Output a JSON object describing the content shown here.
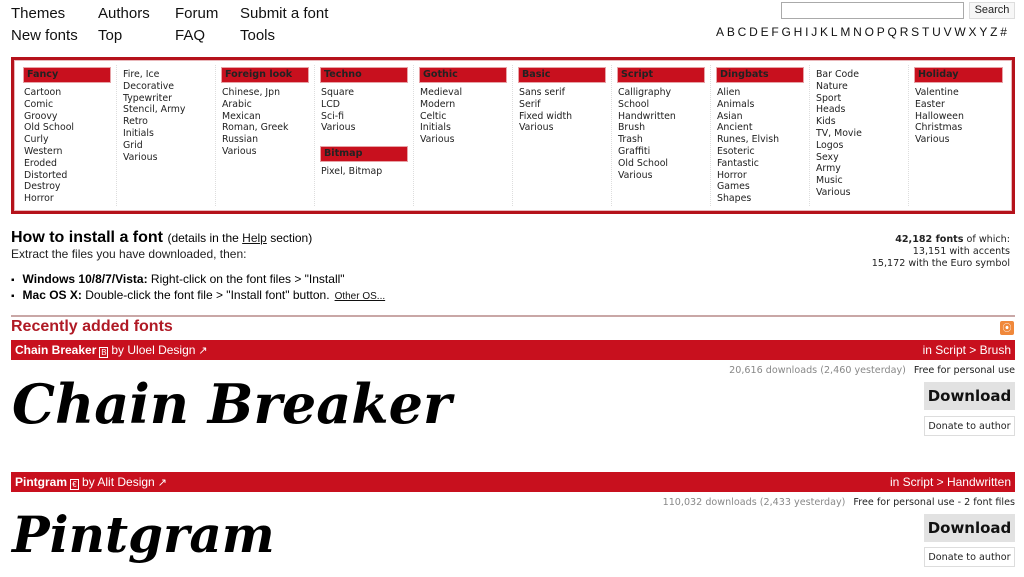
{
  "nav": {
    "items": [
      "Themes",
      "Authors",
      "Forum",
      "Submit a font",
      "New fonts",
      "Top",
      "FAQ",
      "Tools"
    ]
  },
  "search": {
    "value": "",
    "placeholder": "",
    "button": "Search"
  },
  "alphabet": [
    "A",
    "B",
    "C",
    "D",
    "E",
    "F",
    "G",
    "H",
    "I",
    "J",
    "K",
    "L",
    "M",
    "N",
    "O",
    "P",
    "Q",
    "R",
    "S",
    "T",
    "U",
    "V",
    "W",
    "X",
    "Y",
    "Z",
    "#"
  ],
  "categories": [
    {
      "head": "Fancy",
      "items": [
        "Cartoon",
        "Comic",
        "Groovy",
        "Old School",
        "Curly",
        "Western",
        "Eroded",
        "Distorted",
        "Destroy",
        "Horror"
      ]
    },
    {
      "head": "",
      "items": [
        "Fire, Ice",
        "Decorative",
        "Typewriter",
        "Stencil, Army",
        "Retro",
        "Initials",
        "Grid",
        "Various"
      ]
    },
    {
      "head": "Foreign look",
      "items": [
        "Chinese, Jpn",
        "Arabic",
        "Mexican",
        "Roman, Greek",
        "Russian",
        "Various"
      ]
    },
    {
      "head": "Techno",
      "items": [
        "Square",
        "LCD",
        "Sci-fi",
        "Various"
      ],
      "head2": "Bitmap",
      "items2": [
        "Pixel, Bitmap"
      ]
    },
    {
      "head": "Gothic",
      "items": [
        "Medieval",
        "Modern",
        "Celtic",
        "Initials",
        "Various"
      ]
    },
    {
      "head": "Basic",
      "items": [
        "Sans serif",
        "Serif",
        "Fixed width",
        "Various"
      ]
    },
    {
      "head": "Script",
      "items": [
        "Calligraphy",
        "School",
        "Handwritten",
        "Brush",
        "Trash",
        "Graffiti",
        "Old School",
        "Various"
      ]
    },
    {
      "head": "Dingbats",
      "items": [
        "Alien",
        "Animals",
        "Asian",
        "Ancient",
        "Runes, Elvish",
        "Esoteric",
        "Fantastic",
        "Horror",
        "Games",
        "Shapes"
      ]
    },
    {
      "head": "",
      "items": [
        "Bar Code",
        "Nature",
        "Sport",
        "Heads",
        "Kids",
        "TV, Movie",
        "Logos",
        "Sexy",
        "Army",
        "Music",
        "Various"
      ]
    },
    {
      "head": "Holiday",
      "items": [
        "Valentine",
        "Easter",
        "Halloween",
        "Christmas",
        "Various"
      ]
    }
  ],
  "install": {
    "title": "How to install a font",
    "sub_pre": "(details in the ",
    "sub_link": "Help",
    "sub_post": " section)",
    "extract": "Extract the files you have downloaded, then:",
    "win_label": "Windows 10/8/7/Vista:",
    "win_text": " Right-click on the font files > \"Install\"",
    "mac_label": "Mac OS X:",
    "mac_text": " Double-click the font file > \"Install font\" button.",
    "other_os": "Other OS..."
  },
  "stats": {
    "total": "42,182 fonts",
    "total_suffix": " of which:",
    "accents": "13,151 with accents",
    "euro": "15,172 with the Euro symbol"
  },
  "recent": {
    "title": "Recently added fonts",
    "rss_icon": "rss-icon"
  },
  "fonts": [
    {
      "name": "Chain Breaker",
      "type_glyph": "B",
      "by": "by Uloel Design",
      "category": "in Script > Brush",
      "downloads": "20,616 downloads (2,460 yesterday)",
      "license": "Free for personal use",
      "download_label": "Download",
      "donate_label": "Donate to author",
      "preview": "Chain Breaker"
    },
    {
      "name": "Pintgram",
      "type_glyph": "€",
      "by": "by Alit Design",
      "category": "in Script > Handwritten",
      "downloads": "110,032 downloads (2,433 yesterday)",
      "license": "Free for personal use - 2 font files",
      "download_label": "Download",
      "donate_label": "Donate to author",
      "preview": "Pintgram"
    }
  ],
  "colors": {
    "accent": "#c8101e",
    "border": "#b5121b",
    "recent_title": "#b01a25"
  }
}
